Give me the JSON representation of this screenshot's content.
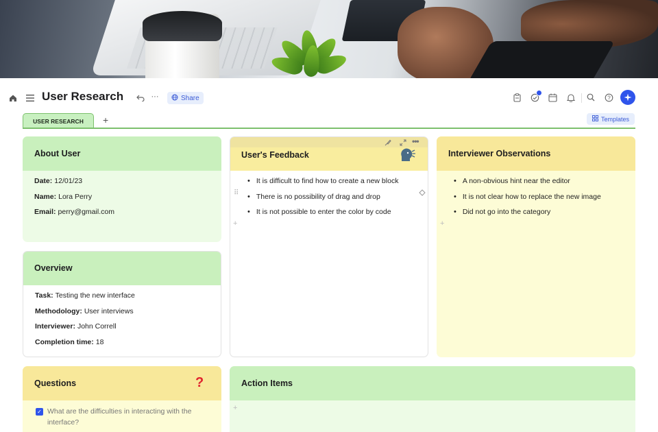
{
  "header": {
    "title": "User Research",
    "share_label": "Share"
  },
  "tabs": [
    {
      "label": "USER RESEARCH",
      "active": true
    }
  ],
  "templates_label": "Templates",
  "cards": {
    "about": {
      "title": "About User",
      "rows": [
        {
          "label": "Date:",
          "value": "12/01/23"
        },
        {
          "label": "Name:",
          "value": "Lora Perry"
        },
        {
          "label": "Email:",
          "value": "perry@gmail.com"
        }
      ]
    },
    "overview": {
      "title": "Overview",
      "rows": [
        {
          "label": "Task:",
          "value": "Testing the new interface"
        },
        {
          "label": "Methodology:",
          "value": "User interviews"
        },
        {
          "label": "Interviewer:",
          "value": "John Correll"
        },
        {
          "label": "Completion time:",
          "value": "18"
        }
      ]
    },
    "feedback": {
      "title": "User's Feedback",
      "items": [
        "It is difficult to find how to create a new block",
        "There is no possibility of drag and drop",
        "It is not possible to enter the color by code"
      ]
    },
    "observations": {
      "title": "Interviewer Observations",
      "items": [
        "A non-obvious hint near the editor",
        "It is not clear how to replace the new image",
        "Did not go into the category"
      ]
    },
    "questions": {
      "title": "Questions",
      "items": [
        {
          "text": "What are the difficulties in interacting with the interface?",
          "checked": true
        }
      ]
    },
    "actions": {
      "title": "Action Items"
    }
  },
  "colors": {
    "accent": "#2f54eb",
    "green_header": "#c9f0bd",
    "yellow_header": "#f8e89a",
    "tab_border": "#7cc06c"
  }
}
